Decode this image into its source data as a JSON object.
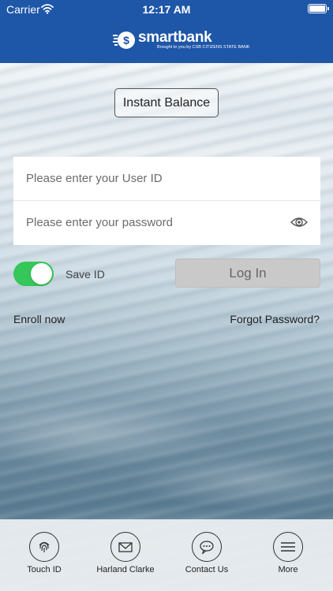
{
  "status_bar": {
    "carrier": "Carrier",
    "time": "12:17 AM"
  },
  "header": {
    "logo_text": "smartbank",
    "logo_subtext": "Brought to you by CSB CITIZENS STATE BANK",
    "brand_color": "#1e56a8"
  },
  "instant_balance": {
    "label": "Instant Balance"
  },
  "form": {
    "user_placeholder": "Please enter your User ID",
    "password_placeholder": "Please enter your password"
  },
  "save_id": {
    "label": "Save ID",
    "enabled": true,
    "toggle_color": "#35c759"
  },
  "login": {
    "label": "Log In"
  },
  "links": {
    "enroll": "Enroll now",
    "forgot": "Forgot Password?"
  },
  "tabs": [
    {
      "label": "Touch ID",
      "icon": "fingerprint-icon"
    },
    {
      "label": "Harland Clarke",
      "icon": "envelope-icon"
    },
    {
      "label": "Contact Us",
      "icon": "chat-bubble-icon"
    },
    {
      "label": "More",
      "icon": "hamburger-menu-icon"
    }
  ]
}
